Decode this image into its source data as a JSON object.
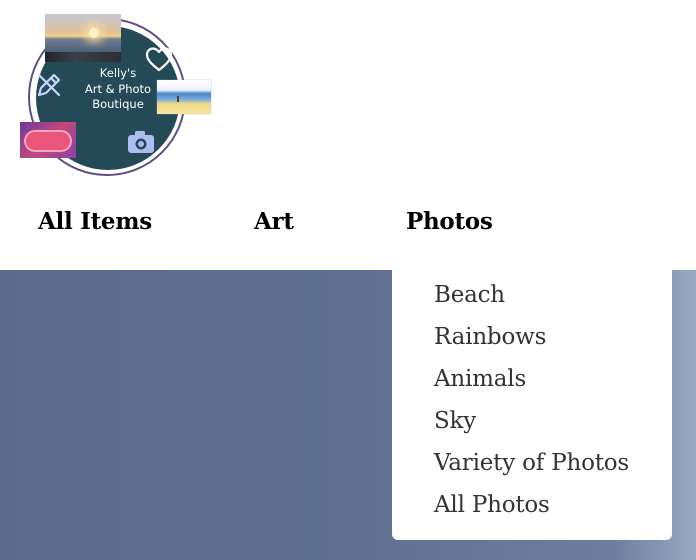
{
  "logo": {
    "line1": "Kelly's",
    "line2": "Art & Photo",
    "line3": "Boutique",
    "accent_color": "#234a56",
    "ring_color": "#5d4f86",
    "icons": [
      "heart-icon",
      "pen-icon",
      "camera-icon"
    ]
  },
  "nav": {
    "items": [
      {
        "label": "All Items"
      },
      {
        "label": "Art"
      },
      {
        "label": "Photos"
      }
    ]
  },
  "dropdown": {
    "items": [
      {
        "label": "Beach"
      },
      {
        "label": "Rainbows"
      },
      {
        "label": "Animals"
      },
      {
        "label": "Sky"
      },
      {
        "label": "Variety of Photos"
      },
      {
        "label": "All Photos"
      }
    ]
  },
  "colors": {
    "hero_background": "#5f7091",
    "dropdown_background": "#ffffff",
    "nav_text": "#000000",
    "dropdown_text": "#333333"
  }
}
